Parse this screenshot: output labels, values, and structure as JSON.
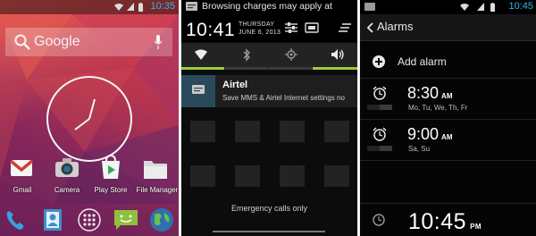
{
  "panel_home": {
    "status_time": "10:35",
    "search_label": "Google",
    "apps": [
      {
        "label": "Gmail",
        "icon": "gmail-icon"
      },
      {
        "label": "Camera",
        "icon": "camera-icon"
      },
      {
        "label": "Play Store",
        "icon": "play-store-icon"
      },
      {
        "label": "File Manager",
        "icon": "folder-icon"
      }
    ],
    "dock": [
      "phone-icon",
      "contacts-icon",
      "app-drawer-icon",
      "messaging-icon",
      "browser-icon"
    ],
    "colors": {
      "accent_time": "#33b5e5"
    }
  },
  "panel_shade": {
    "status_text": "Browsing charges may apply at",
    "time": "10:41",
    "day": "THURSDAY",
    "date": "JUNE 6, 2013",
    "quick_tiles": [
      "wifi-icon",
      "bluetooth-icon",
      "gps-icon",
      "sound-icon"
    ],
    "notification": {
      "title": "Airtel",
      "text": "Save MMS & Airtel Internet settings no"
    },
    "footer": "Emergency calls only"
  },
  "panel_alarms": {
    "status_time": "10:45",
    "title": "Alarms",
    "add_label": "Add alarm",
    "alarms": [
      {
        "time": "8:30",
        "ampm": "AM",
        "days": "Mo, Tu, We, Th, Fr"
      },
      {
        "time": "9:00",
        "ampm": "AM",
        "days": "Sa, Su"
      }
    ],
    "current_time": "10:45",
    "current_ampm": "PM"
  }
}
